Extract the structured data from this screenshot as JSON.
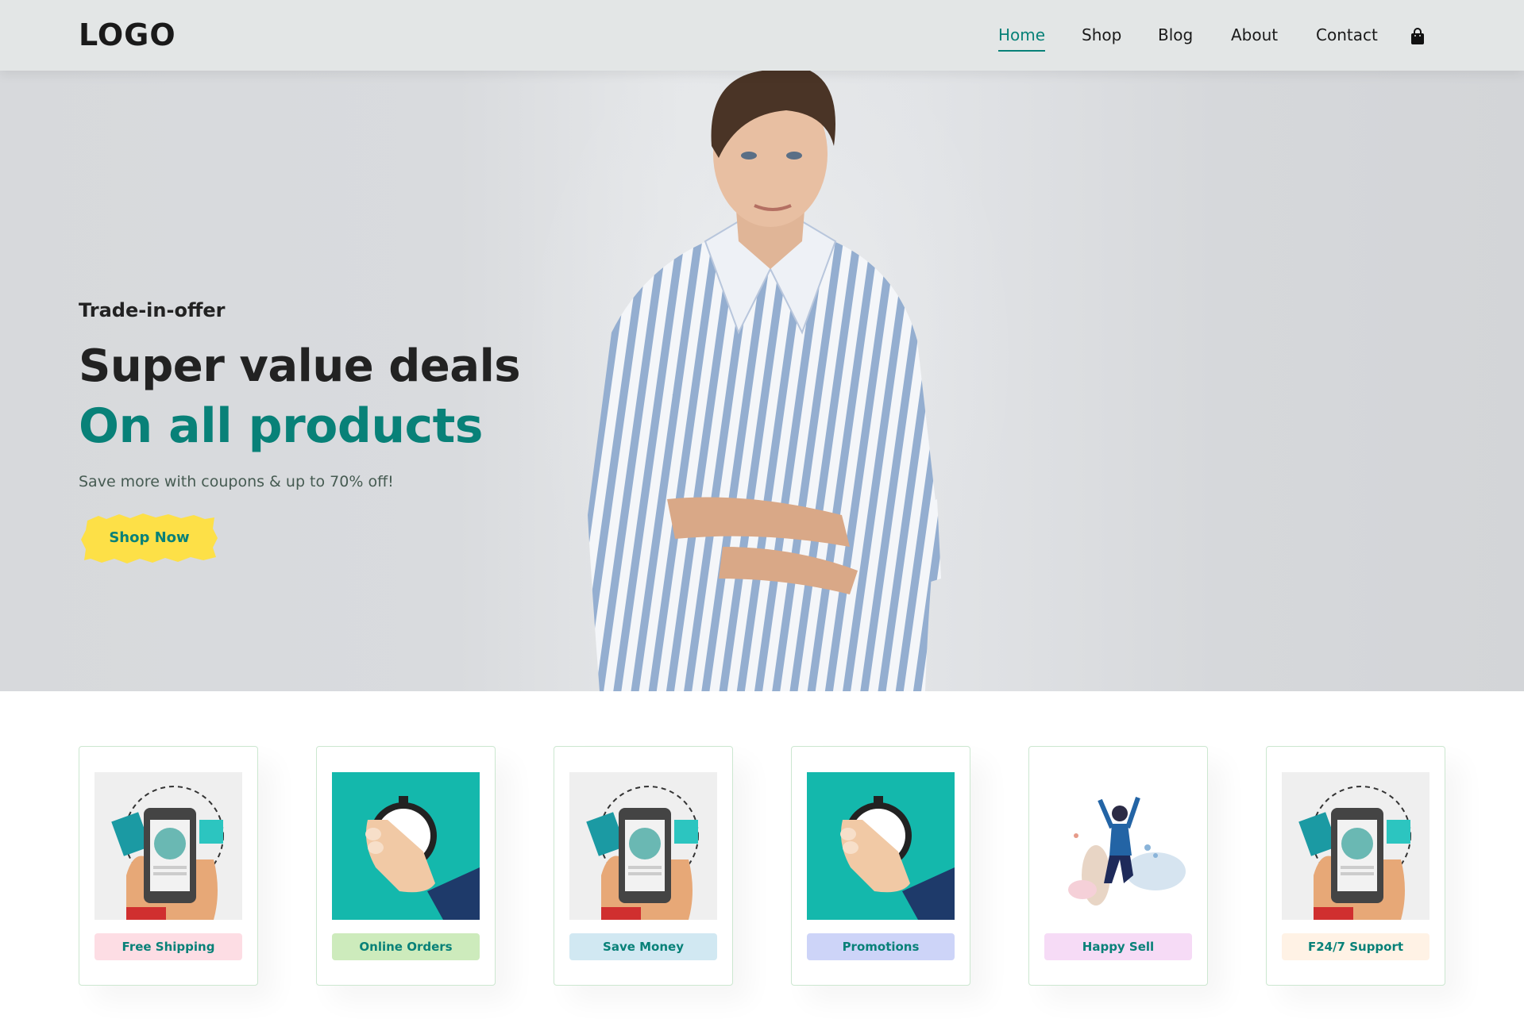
{
  "header": {
    "logo": "LOGO",
    "nav": [
      {
        "label": "Home",
        "active": true
      },
      {
        "label": "Shop",
        "active": false
      },
      {
        "label": "Blog",
        "active": false
      },
      {
        "label": "About",
        "active": false
      },
      {
        "label": "Contact",
        "active": false
      }
    ],
    "cart_icon": "shopping-bag-icon"
  },
  "hero": {
    "subtitle": "Trade-in-offer",
    "title": "Super value deals",
    "title_accent": "On all products",
    "description": "Save more with coupons & up to 70% off!",
    "button_label": "Shop Now",
    "colors": {
      "accent": "#088178",
      "button": "#fde047"
    }
  },
  "features": [
    {
      "label": "Free Shipping",
      "bg": "#fddde4",
      "image": "phone-shopping-illustration"
    },
    {
      "label": "Online Orders",
      "bg": "#cdebbc",
      "image": "stopwatch-illustration"
    },
    {
      "label": "Save Money",
      "bg": "#d1e8f2",
      "image": "phone-shopping-illustration"
    },
    {
      "label": "Promotions",
      "bg": "#cdd4f8",
      "image": "stopwatch-illustration"
    },
    {
      "label": "Happy Sell",
      "bg": "#f6dbf6",
      "image": "happy-woman-illustration"
    },
    {
      "label": "F24/7 Support",
      "bg": "#fff2e5",
      "image": "phone-shopping-illustration"
    }
  ]
}
